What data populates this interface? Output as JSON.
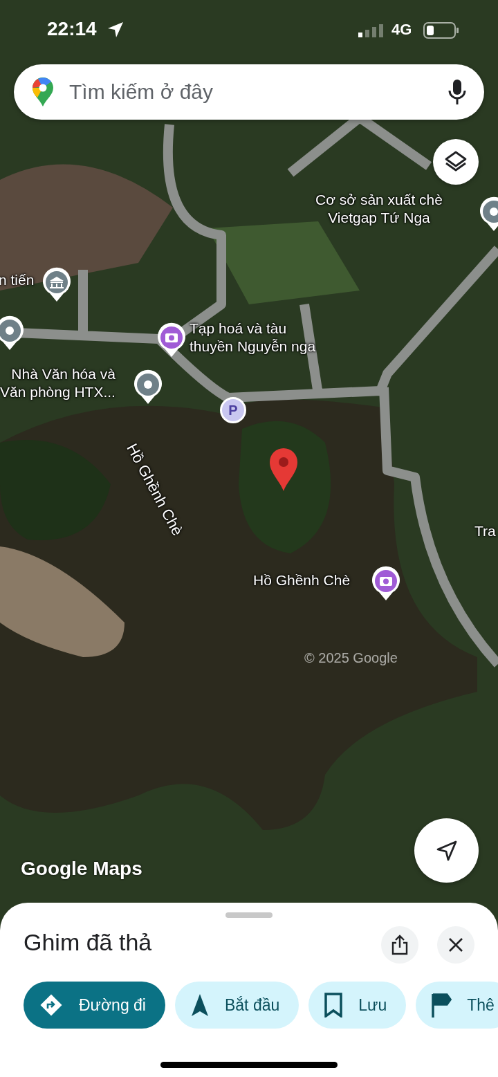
{
  "status_bar": {
    "time": "22:14",
    "network": "4G"
  },
  "search": {
    "placeholder": "Tìm kiếm ở đây"
  },
  "map": {
    "labels": [
      {
        "text": "Cơ sở sản xuất chè\nVietgap Tứ Nga",
        "kind": "plain"
      },
      {
        "kind": "info"
      },
      {
        "text": "n tiến",
        "kind": "building"
      },
      {
        "kind": "info"
      },
      {
        "text": "Tạp hoá và tàu\nthuyền Nguyễn nga",
        "kind": "camera"
      },
      {
        "text": "Nhà Văn hóa và\nVăn phòng HTX...",
        "kind": "info"
      },
      {
        "text": "P",
        "kind": "parking"
      },
      {
        "text": "Hồ Ghềnh Chè",
        "kind": "water"
      },
      {
        "text": "Hồ Ghềnh Chè",
        "kind": "camera"
      },
      {
        "text": "Tra",
        "kind": "plain"
      }
    ],
    "copyright": "© 2025 Google",
    "logo": "Google Maps"
  },
  "sheet": {
    "title": "Ghim đã thả",
    "chips": [
      {
        "label": "Đường đi",
        "kind": "primary"
      },
      {
        "label": "Bắt đầu",
        "kind": "tonal"
      },
      {
        "label": "Lưu",
        "kind": "tonal"
      },
      {
        "label": "Thê",
        "kind": "tonal"
      }
    ]
  }
}
